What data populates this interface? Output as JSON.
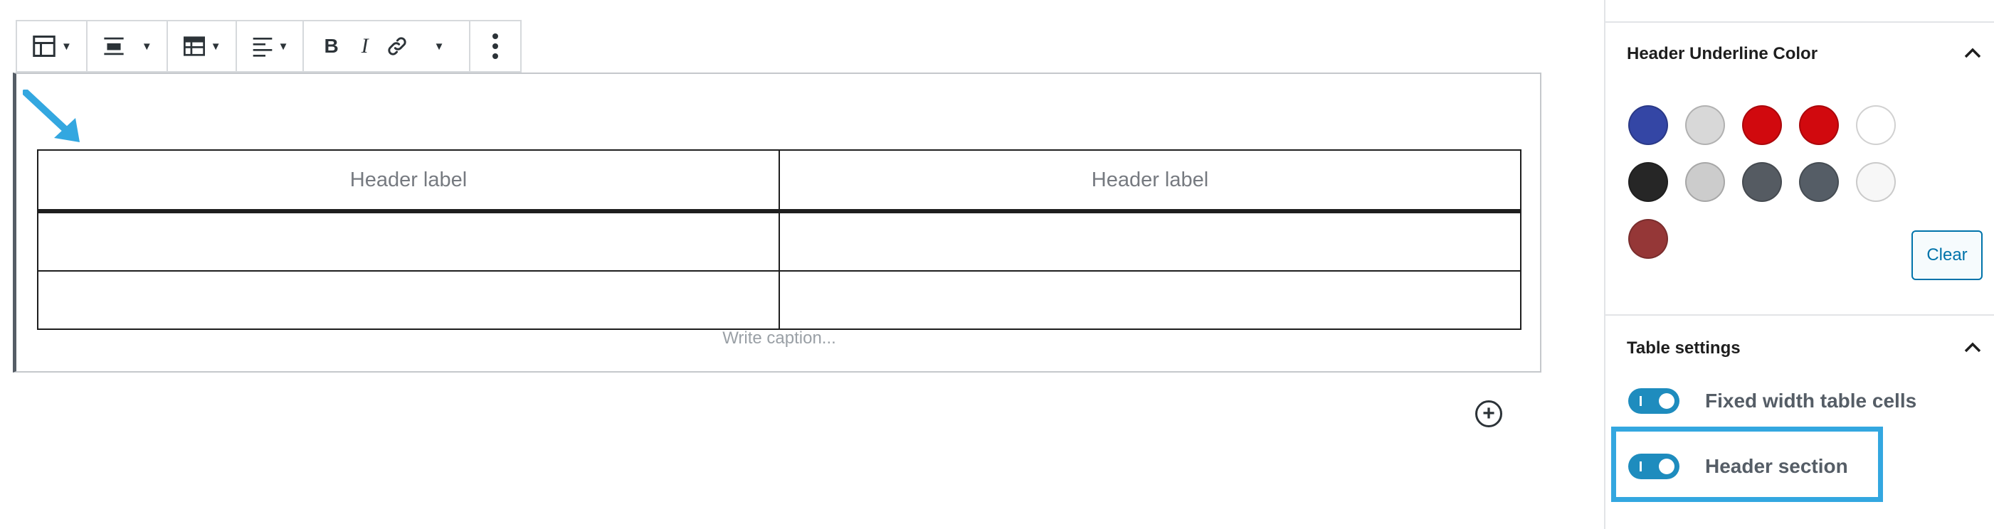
{
  "editor": {
    "table": {
      "headers": [
        "Header label",
        "Header label"
      ],
      "rows": [
        [
          "",
          ""
        ],
        [
          "",
          ""
        ]
      ],
      "caption_placeholder": "Write caption..."
    },
    "toolbar": {
      "icons": [
        "table-icon",
        "align-wide-icon",
        "table-edit-icon",
        "align-left-icon",
        "bold-icon",
        "italic-icon",
        "link-icon",
        "more-options-icon"
      ],
      "bold_label": "B",
      "italic_label": "I"
    }
  },
  "sidebar": {
    "color_panel": {
      "title": "Header Underline Color",
      "swatches": [
        "#3446a5",
        "#d8d8d8",
        "#d1090e",
        "#d1090e",
        "#ffffff",
        "#262626",
        "#cccccc",
        "#555b62",
        "#555d66",
        "#f7f7f7",
        "#953737"
      ],
      "clear_label": "Clear"
    },
    "table_settings": {
      "title": "Table settings",
      "fixed_width": {
        "label": "Fixed width table cells",
        "enabled": true
      },
      "header_section": {
        "label": "Header section",
        "enabled": true
      }
    }
  },
  "colors": {
    "accent": "#0073aa",
    "toggle": "#1e8cbe",
    "highlight": "#33a7e0"
  }
}
